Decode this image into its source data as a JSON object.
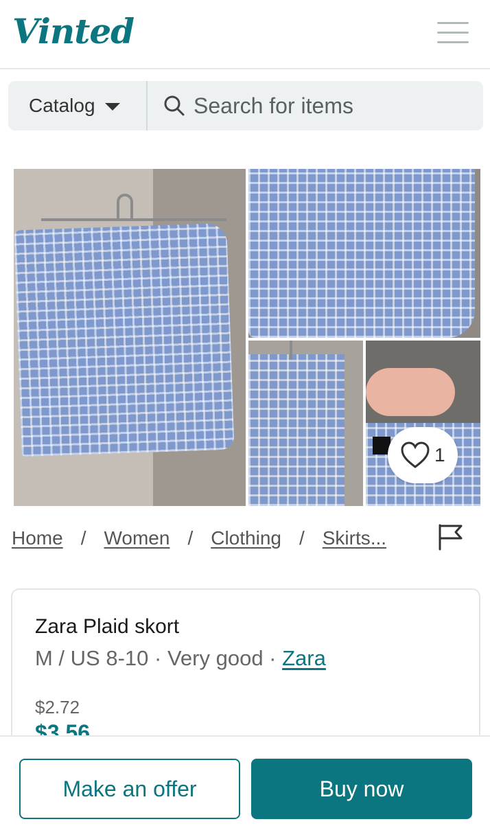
{
  "header": {
    "logo_text": "Vinted",
    "menu_icon": "hamburger-menu-icon"
  },
  "search": {
    "catalog_label": "Catalog",
    "placeholder": "Search for items"
  },
  "gallery": {
    "photo_count": 4,
    "favorite_count": "1"
  },
  "breadcrumb": [
    {
      "label": "Home"
    },
    {
      "label": "Women"
    },
    {
      "label": "Clothing"
    },
    {
      "label": "Skirts..."
    }
  ],
  "breadcrumb_separator": "/",
  "item": {
    "title": "Zara Plaid skort",
    "size": "M / US 8-10",
    "condition": "Very good",
    "brand": "Zara",
    "meta_separator": " · ",
    "price": "$2.72",
    "price_with_fees": "$3.56"
  },
  "actions": {
    "offer_label": "Make an offer",
    "buy_label": "Buy now"
  },
  "colors": {
    "brand": "#0b7580",
    "fabric": "#7f99cc"
  }
}
